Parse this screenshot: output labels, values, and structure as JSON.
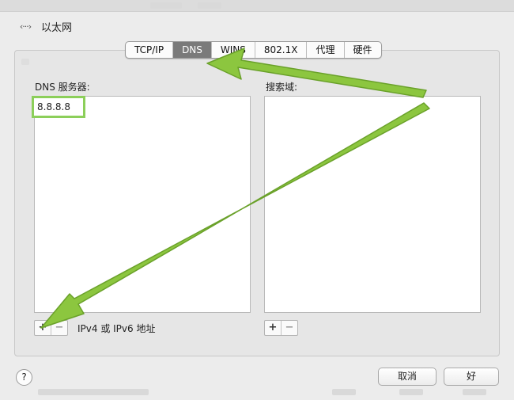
{
  "header": {
    "icon": "ethernet-icon",
    "title": "以太网"
  },
  "tabs": [
    {
      "label": "TCP/IP",
      "active": false
    },
    {
      "label": "DNS",
      "active": true
    },
    {
      "label": "WINS",
      "active": false
    },
    {
      "label": "802.1X",
      "active": false
    },
    {
      "label": "代理",
      "active": false
    },
    {
      "label": "硬件",
      "active": false
    }
  ],
  "dns_panel": {
    "label": "DNS 服务器:",
    "servers": [
      "8.8.8.8"
    ],
    "add_label": "+",
    "remove_label": "−",
    "hint": "IPv4 或 IPv6 地址"
  },
  "search_panel": {
    "label": "搜索域:",
    "add_label": "+",
    "remove_label": "−"
  },
  "footer": {
    "help_label": "?",
    "cancel_label": "取消",
    "ok_label": "好"
  },
  "colors": {
    "annotation_arrow": "#8cc63f",
    "annotation_arrow_outline": "#6aa12a",
    "highlight_border": "#8ccf5a",
    "active_tab": "#7a7a7a"
  }
}
